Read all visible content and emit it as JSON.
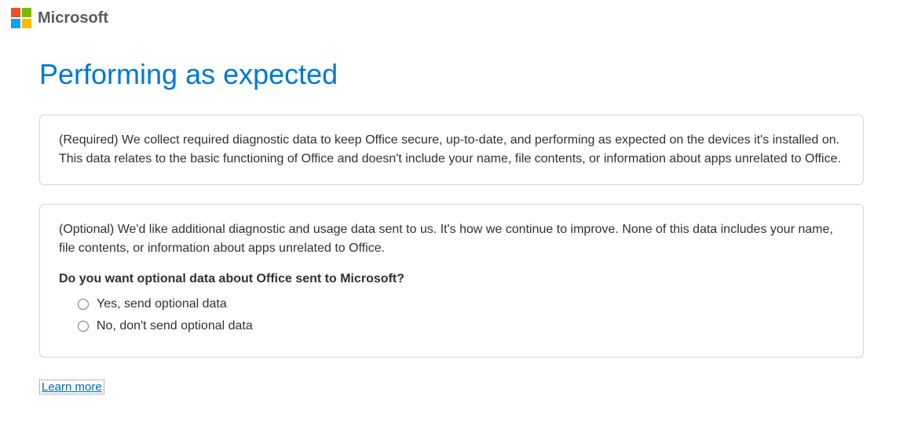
{
  "brand": {
    "name": "Microsoft"
  },
  "page": {
    "title": "Performing as expected"
  },
  "required_box": {
    "text": "(Required) We collect required diagnostic data to keep Office secure, up-to-date, and performing as expected on the devices it's installed on. This data relates to the basic functioning of Office and doesn't include your name, file contents, or information about apps unrelated to Office."
  },
  "optional_box": {
    "intro": "(Optional) We'd like additional diagnostic and usage data sent to us. It's how we continue to improve. None of this data includes your name, file contents, or information about apps unrelated to Office.",
    "question": "Do you want optional data about Office sent to Microsoft?",
    "options": {
      "yes": "Yes, send optional data",
      "no": "No, don't send optional data"
    }
  },
  "links": {
    "learn_more": "Learn more"
  }
}
